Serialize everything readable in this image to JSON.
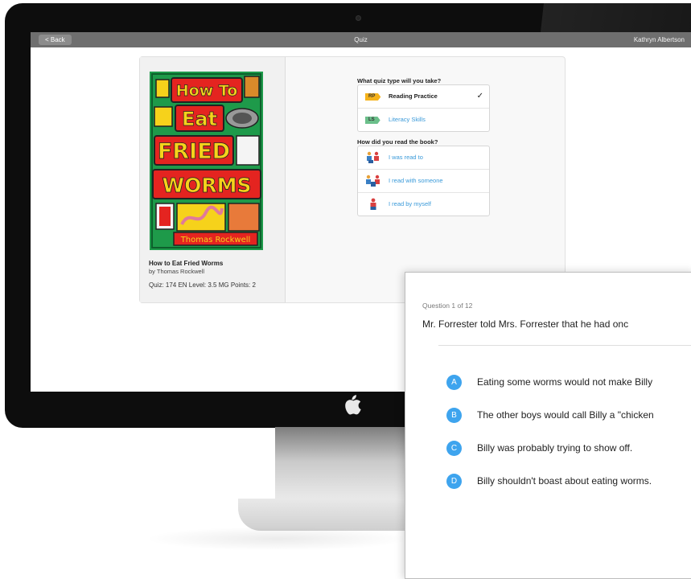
{
  "topbar": {
    "back_label": "< Back",
    "title": "Quiz",
    "user": "Kathryn Albertson"
  },
  "book": {
    "cover": {
      "line1": "How To",
      "line2": "Eat",
      "line3": "FRIED",
      "line4": "WORMS",
      "author": "Thomas Rockwell"
    },
    "title": "How to Eat Fried Worms",
    "byline": "by Thomas Rockwell",
    "meta": "Quiz: 174 EN   Level: 3.5 MG   Points: 2"
  },
  "quiz_type": {
    "heading": "What quiz type will you take?",
    "options": [
      {
        "tag": "RP",
        "label": "Reading Practice",
        "selected": true,
        "tag_color": "#f5b21a"
      },
      {
        "tag": "LS",
        "label": "Literacy Skills",
        "selected": false,
        "tag_color": "#6bbf8a"
      }
    ],
    "check": "✓"
  },
  "read_mode": {
    "heading": "How did you read the book?",
    "options": [
      {
        "label": "I was read to",
        "icon": "read-to-icon"
      },
      {
        "label": "I read with someone",
        "icon": "read-with-someone-icon"
      },
      {
        "label": "I read by myself",
        "icon": "read-by-myself-icon"
      }
    ]
  },
  "question": {
    "progress": "Question 1 of 12",
    "text": "Mr. Forrester told Mrs. Forrester that he had onc",
    "answers": [
      {
        "letter": "A",
        "text": "Eating some worms would not make Billy"
      },
      {
        "letter": "B",
        "text": "The other boys would call Billy a \"chicken"
      },
      {
        "letter": "C",
        "text": "Billy was probably trying to show off."
      },
      {
        "letter": "D",
        "text": "Billy shouldn't boast about eating worms."
      }
    ]
  },
  "colors": {
    "accent_blue": "#3ea4ee",
    "link_blue": "#3a9ad9",
    "topbar_gray": "#6f6f6f"
  }
}
